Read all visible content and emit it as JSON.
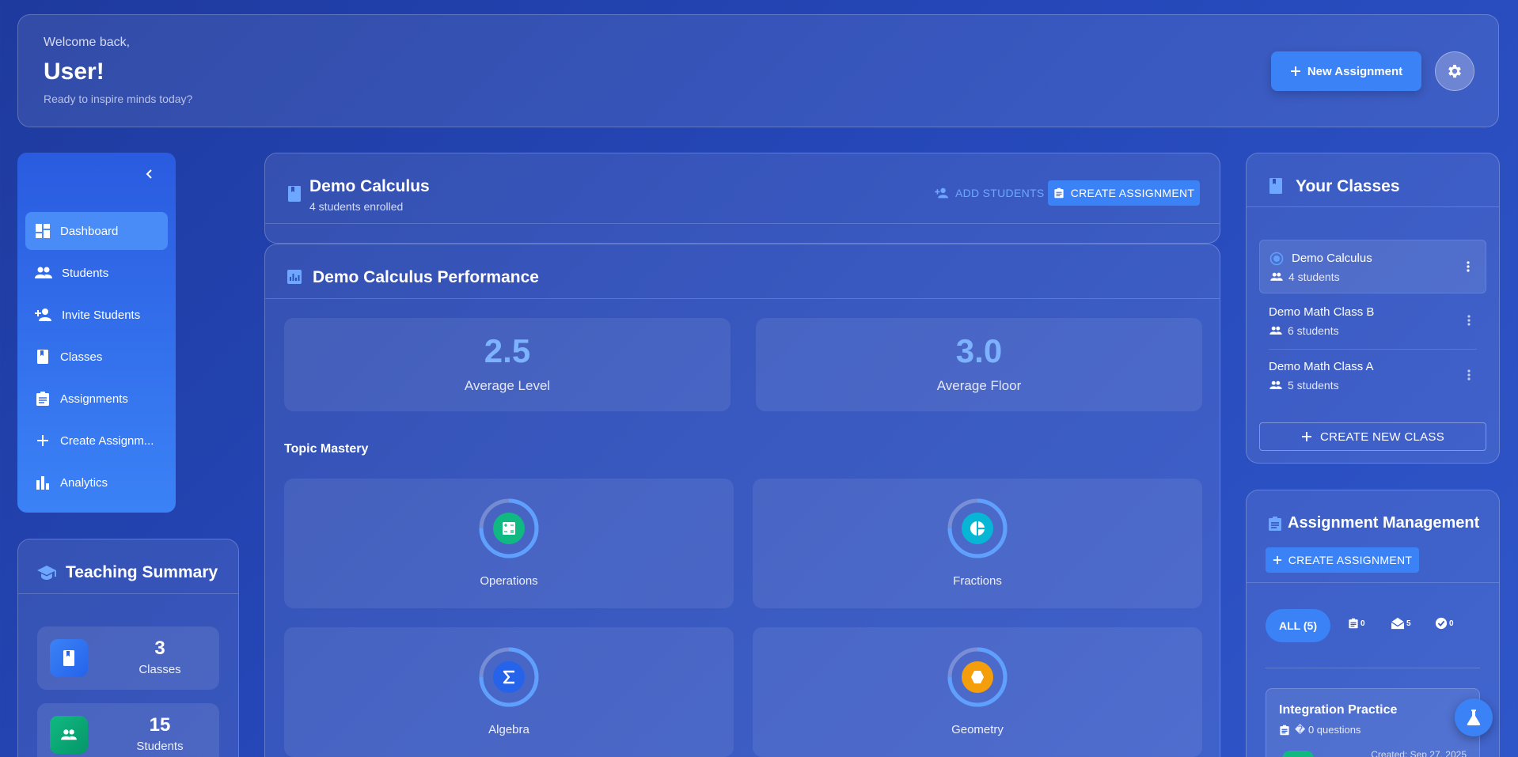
{
  "header": {
    "welcome": "Welcome back,",
    "user": "User!",
    "tagline": "Ready to inspire minds today?",
    "new_assignment_label": "New Assignment",
    "settings_icon": "gear-icon"
  },
  "sidebar": {
    "items": [
      {
        "label": "Dashboard",
        "icon": "dashboard-icon",
        "active": true
      },
      {
        "label": "Students",
        "icon": "people-icon"
      },
      {
        "label": "Invite Students",
        "icon": "person-add-icon"
      },
      {
        "label": "Classes",
        "icon": "book-icon"
      },
      {
        "label": "Assignments",
        "icon": "assignment-icon"
      },
      {
        "label": "Create Assignm...",
        "icon": "plus-icon"
      },
      {
        "label": "Analytics",
        "icon": "bar-chart-icon"
      }
    ]
  },
  "summary": {
    "title": "Teaching Summary",
    "stats": [
      {
        "value": "3",
        "label": "Classes",
        "color": "#3b82f6"
      },
      {
        "value": "15",
        "label": "Students",
        "color": "#10b981"
      }
    ]
  },
  "class_header": {
    "title": "Demo Calculus",
    "subtitle": "4 students enrolled",
    "add_students": "ADD STUDENTS",
    "create_assignment": "CREATE ASSIGNMENT"
  },
  "performance": {
    "title": "Demo Calculus Performance",
    "metrics": [
      {
        "value": "2.5",
        "label": "Average Level"
      },
      {
        "value": "3.0",
        "label": "Average Floor"
      }
    ],
    "topic_heading": "Topic Mastery",
    "topics": [
      {
        "label": "Operations",
        "icon": "calculator-icon",
        "color": "#10b981",
        "progress": 0.75
      },
      {
        "label": "Fractions",
        "icon": "pie-chart-icon",
        "color": "#06b6d4",
        "progress": 0.75
      },
      {
        "label": "Algebra",
        "icon": "sigma-icon",
        "color": "#2563eb",
        "progress": 0.75
      },
      {
        "label": "Geometry",
        "icon": "hexagon-icon",
        "color": "#f59e0b",
        "progress": 0.75
      }
    ]
  },
  "classes": {
    "title": "Your Classes",
    "items": [
      {
        "name": "Demo Calculus",
        "count": "4 students",
        "selected": true
      },
      {
        "name": "Demo Math Class B",
        "count": "6 students"
      },
      {
        "name": "Demo Math Class A",
        "count": "5 students"
      }
    ],
    "create_label": "CREATE NEW CLASS"
  },
  "assignments": {
    "title": "Assignment Management",
    "create_label": "CREATE ASSIGNMENT",
    "filter_all": "ALL (5)",
    "filters": [
      {
        "icon": "assignment-icon",
        "count": "0"
      },
      {
        "icon": "drafts-icon",
        "count": "5"
      },
      {
        "icon": "check-circle-icon",
        "count": "0"
      }
    ],
    "card": {
      "name": "Integration Practice",
      "questions": "� 0 questions",
      "created": "Created: Sep 27, 2025"
    }
  }
}
